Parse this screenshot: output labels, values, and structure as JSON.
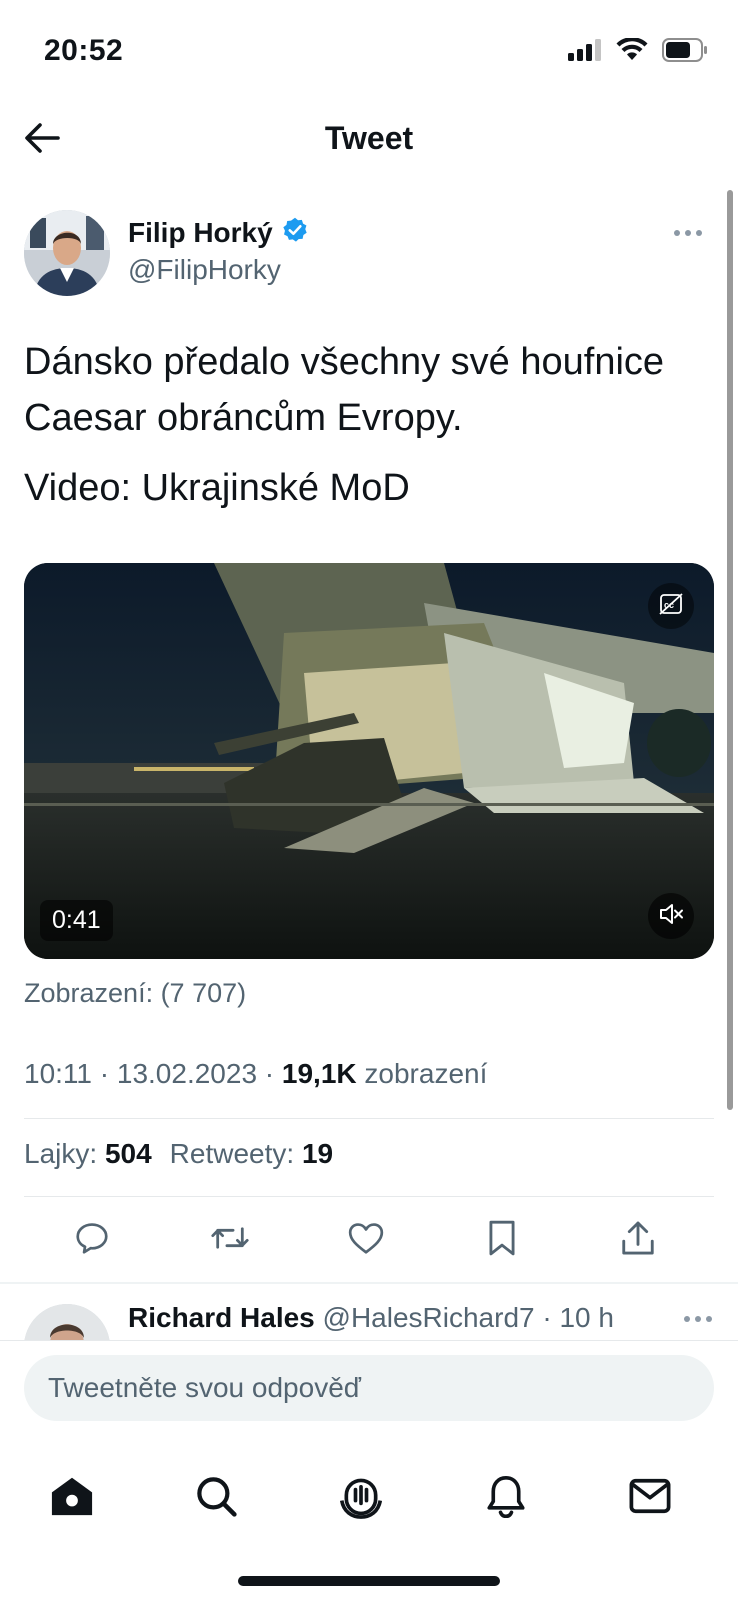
{
  "status_bar": {
    "time": "20:52",
    "icons": [
      "signal-icon",
      "wifi-icon",
      "battery-icon"
    ]
  },
  "header": {
    "title": "Tweet",
    "back_icon": "back-arrow-icon"
  },
  "tweet": {
    "author_name": "Filip Horký",
    "author_handle": "@FilipHorky",
    "verified": true,
    "text_line1": "Dánsko předalo všechny své houfnice Caesar obráncům Evropy.",
    "text_line2": "Video: Ukrajinské MoD",
    "media": {
      "duration": "0:41",
      "icons": [
        "captions-off-icon",
        "mute-icon"
      ]
    },
    "views_label": "Zobrazení: (7 707)",
    "timestamp": "10:11 · 13.02.2023 · ",
    "view_count": "19,1K",
    "view_word": " zobrazení",
    "likes_label": "Lajky: ",
    "likes_count": "504",
    "retweets_label": "Retweety: ",
    "retweets_count": "19",
    "actions": [
      "reply-icon",
      "retweet-icon",
      "like-icon",
      "bookmark-icon",
      "share-icon"
    ]
  },
  "reply": {
    "name": "Richard Hales",
    "handle": " @HalesRichard7 · 10 h"
  },
  "reply_bar": {
    "placeholder": "Tweetněte svou odpověď"
  },
  "bottom_nav": {
    "items": [
      "home-icon",
      "search-icon",
      "spaces-icon",
      "notifications-icon",
      "messages-icon"
    ]
  },
  "colors": {
    "text_primary": "#0f1419",
    "text_secondary": "#536471",
    "verified_blue": "#1d9bf0",
    "input_bg": "#eff3f4"
  }
}
